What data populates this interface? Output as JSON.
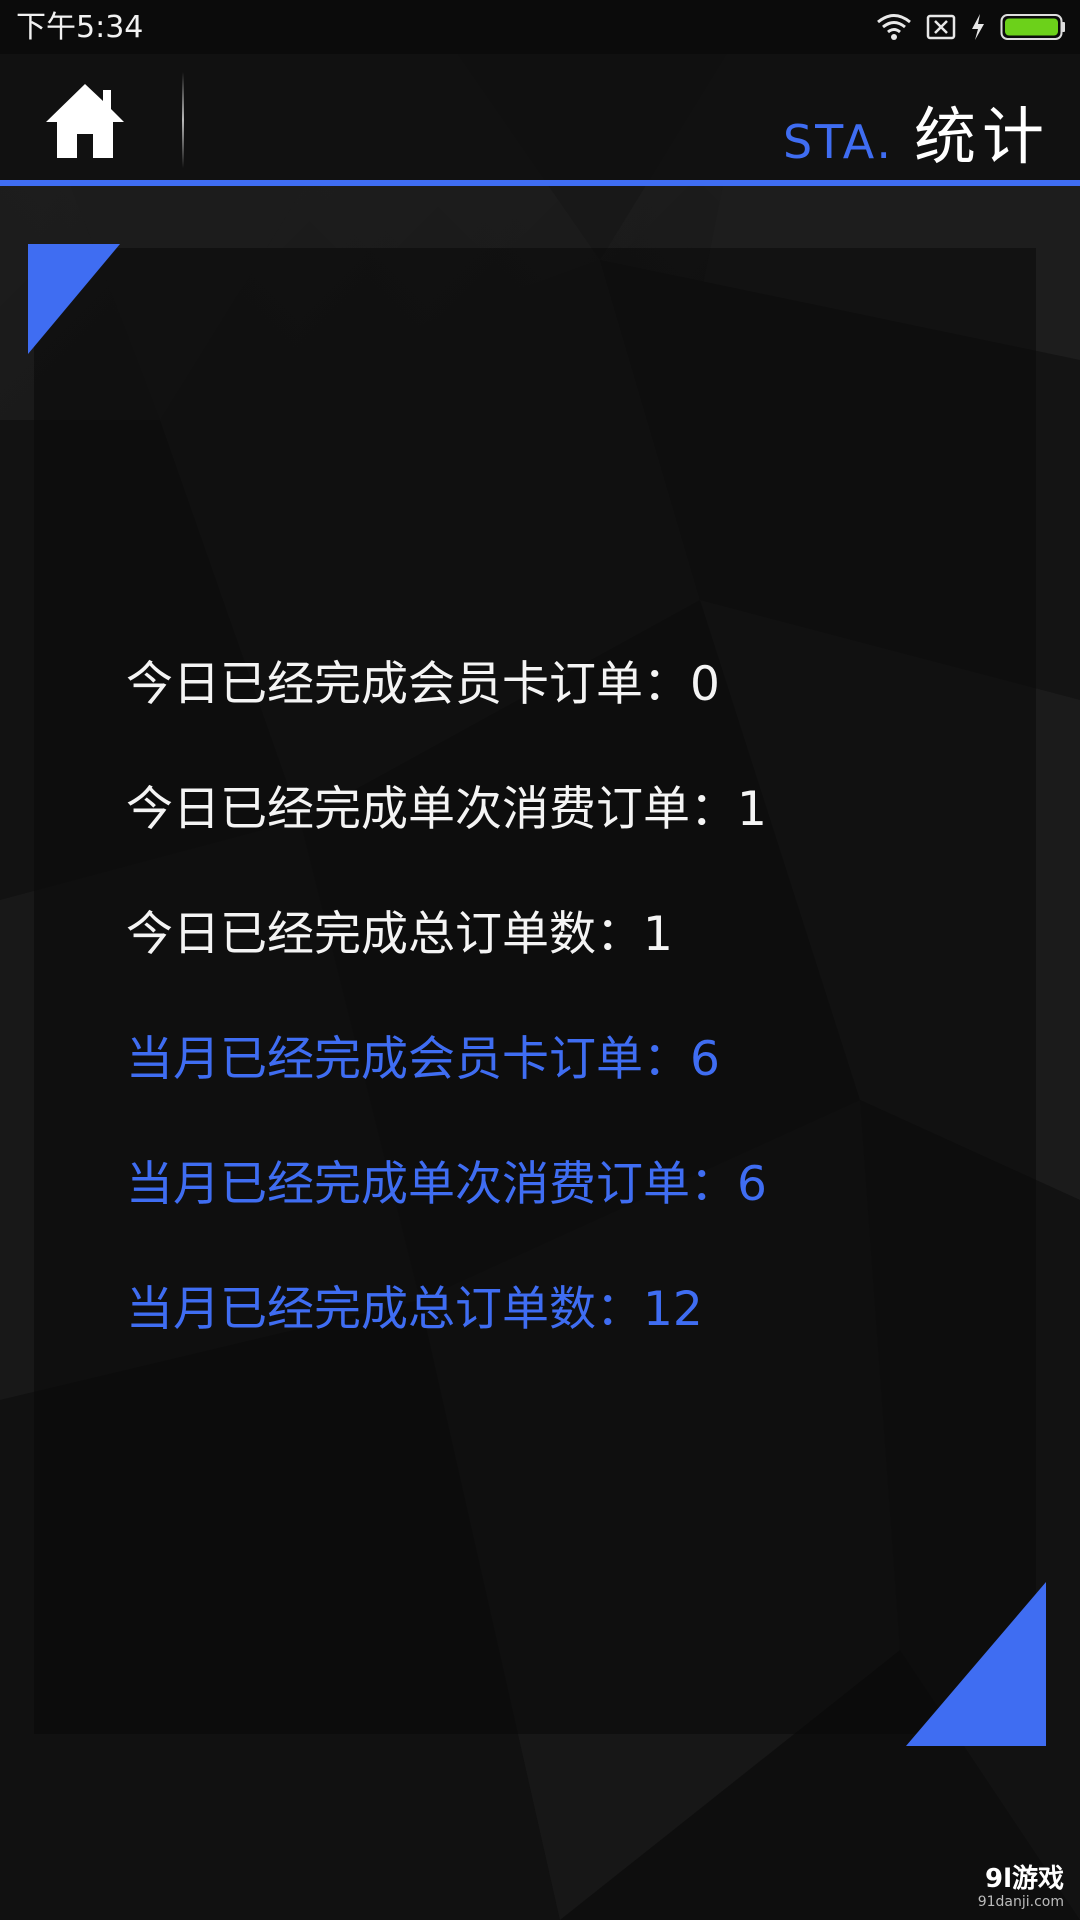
{
  "status_bar": {
    "time": "下午5:34",
    "icons": [
      "wifi-icon",
      "sim-off-icon",
      "charging-icon",
      "battery-icon"
    ],
    "battery_color": "#6cd11a"
  },
  "header": {
    "home_icon": "home-icon",
    "title_en": "STA.",
    "title_cn": "统计"
  },
  "colors": {
    "accent": "#3f6df2",
    "text_today": "#f4f4f4",
    "background": "#151515"
  },
  "stats": {
    "today": [
      {
        "label": "今日已经完成会员卡订单：",
        "value": "0"
      },
      {
        "label": "今日已经完成单次消费订单：",
        "value": "1"
      },
      {
        "label": "今日已经完成总订单数：",
        "value": "1"
      }
    ],
    "month": [
      {
        "label": "当月已经完成会员卡订单：",
        "value": "6"
      },
      {
        "label": "当月已经完成单次消费订单：",
        "value": "6"
      },
      {
        "label": "当月已经完成总订单数：",
        "value": "12"
      }
    ]
  },
  "watermark": {
    "main": "9l游戏",
    "sub": "91danji.com"
  }
}
